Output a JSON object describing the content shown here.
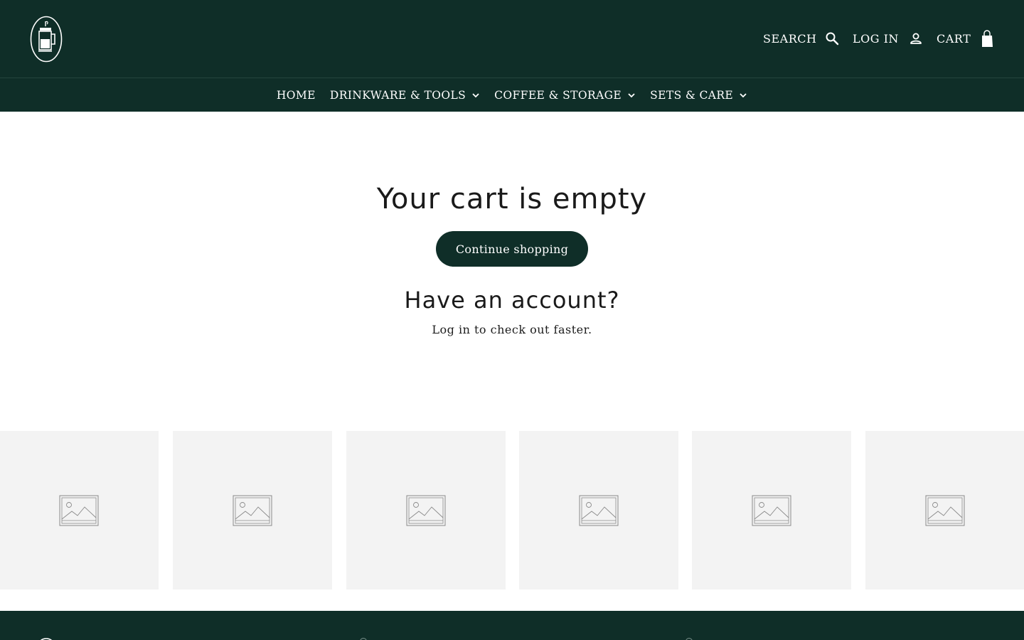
{
  "header": {
    "logo_icon": "french-press-logo-icon",
    "search_label": "SEARCH",
    "search_icon": "search-icon",
    "login_label": "LOG IN",
    "login_icon": "account-icon",
    "cart_label": "CART",
    "cart_icon": "shopping-bag-icon"
  },
  "nav": {
    "items": [
      {
        "label": "HOME",
        "has_dropdown": false
      },
      {
        "label": "DRINKWARE & TOOLS",
        "has_dropdown": true
      },
      {
        "label": "COFFEE & STORAGE",
        "has_dropdown": true
      },
      {
        "label": "SETS & CARE",
        "has_dropdown": true
      }
    ]
  },
  "cart": {
    "empty_title": "Your cart is empty",
    "continue_label": "Continue shopping",
    "account_title": "Have an account?",
    "login_link": "Log in",
    "login_suffix": " to check out faster."
  },
  "placeholders": {
    "count": 6,
    "icon": "image-placeholder-icon"
  },
  "colors": {
    "brand_dark_green": "#0f2e28",
    "tile_bg": "#f3f3f3",
    "text": "#1c1c1c"
  }
}
